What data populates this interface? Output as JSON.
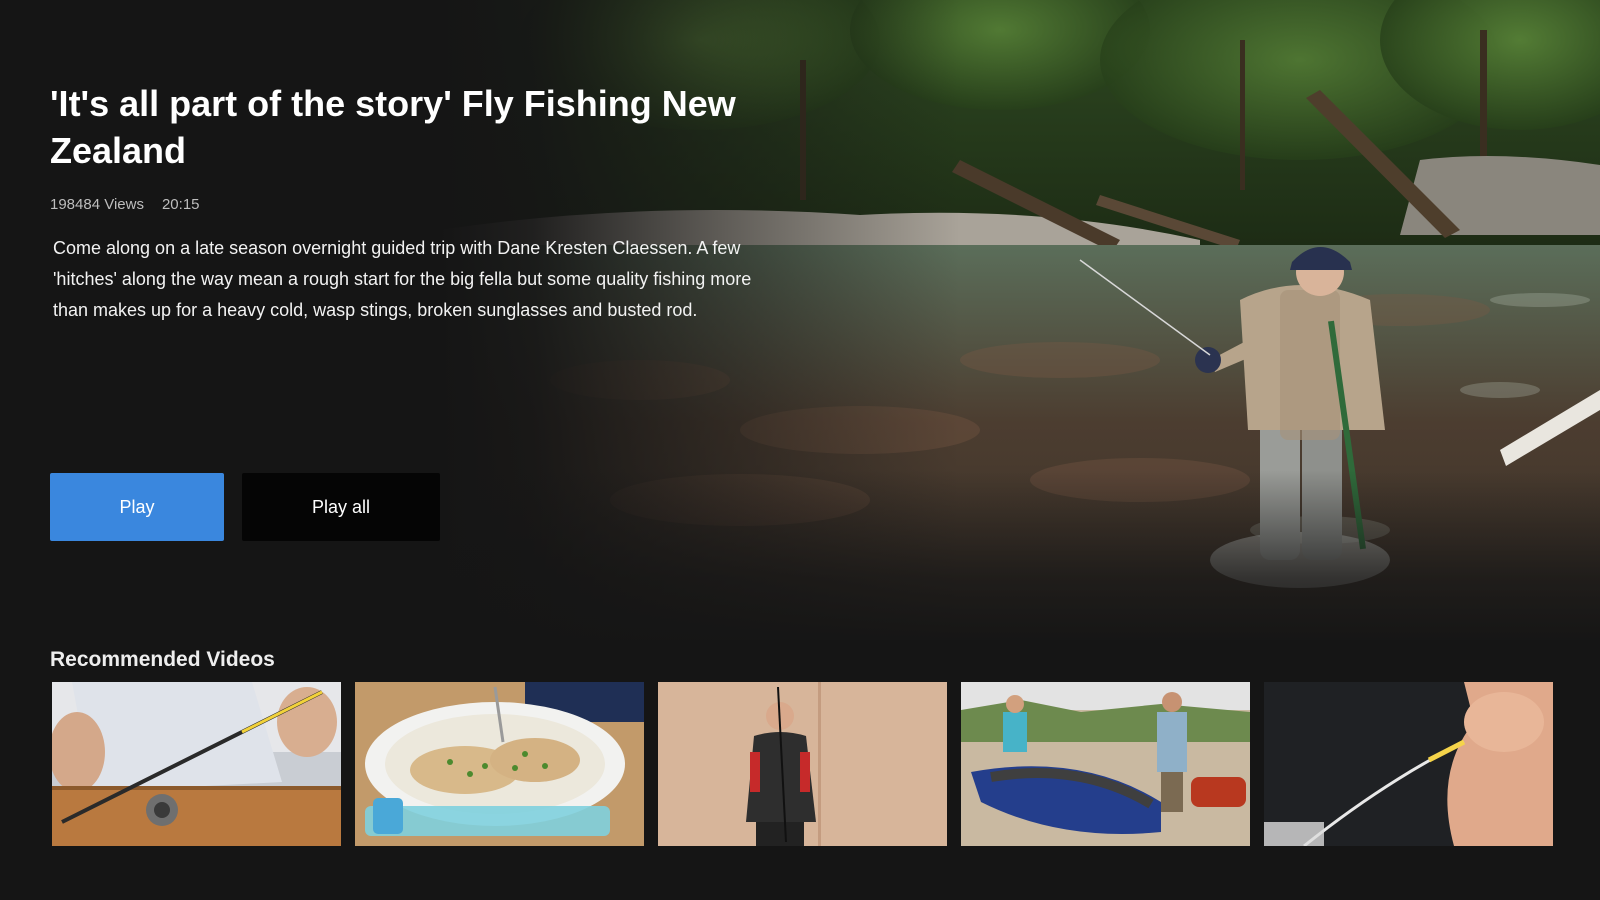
{
  "video": {
    "title": "'It's all part of the story' Fly Fishing New Zealand",
    "views": "198484 Views",
    "duration": "20:15",
    "description": "Come along on a late season overnight guided trip with Dane Kresten Claessen. A few 'hitches' along the way mean a rough start for the big fella but some quality fishing more than makes up for a heavy cold, wasp stings, broken sunglasses and busted rod."
  },
  "actions": {
    "play_label": "Play",
    "play_all_label": "Play all"
  },
  "recommended": {
    "header": "Recommended Videos",
    "items": [
      {
        "name": "thumbnail-fly-rod-on-bench"
      },
      {
        "name": "thumbnail-fish-dish-plate"
      },
      {
        "name": "thumbnail-man-casting-indoors"
      },
      {
        "name": "thumbnail-inflatable-raft-river"
      },
      {
        "name": "thumbnail-tying-fly-knot"
      }
    ]
  },
  "colors": {
    "background": "#151515",
    "primary_button": "#3a87de",
    "secondary_button": "#050505",
    "meta_text": "#bdbdbd"
  }
}
